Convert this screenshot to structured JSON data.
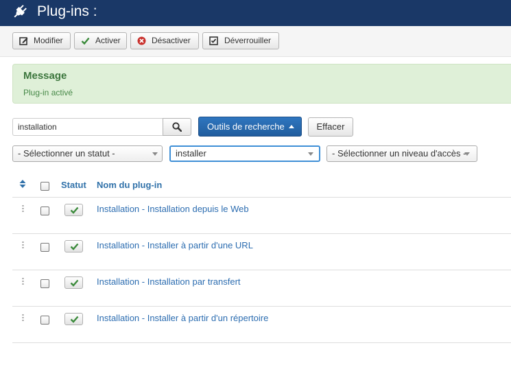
{
  "header": {
    "title": "Plug-ins :",
    "icon": "plug-icon"
  },
  "toolbar": {
    "edit_label": "Modifier",
    "enable_label": "Activer",
    "disable_label": "Désactiver",
    "unlock_label": "Déverrouiller"
  },
  "message": {
    "heading": "Message",
    "text": "Plug-in activé",
    "color": "#dff0d8"
  },
  "filters": {
    "search_value": "installation",
    "search_tools_label": "Outils de recherche",
    "clear_label": "Effacer",
    "status_select": "- Sélectionner un statut -",
    "folder_select": "installer",
    "access_select": "- Sélectionner un niveau d'accès -"
  },
  "table": {
    "col_status": "Statut",
    "col_name": "Nom du plug-in",
    "rows": [
      {
        "name": "Installation - Installation depuis le Web",
        "enabled": true
      },
      {
        "name": "Installation - Installer à partir d'une URL",
        "enabled": true
      },
      {
        "name": "Installation - Installation par transfert",
        "enabled": true
      },
      {
        "name": "Installation - Installer à partir d'un répertoire",
        "enabled": true
      }
    ]
  },
  "colors": {
    "header_bg": "#1a3867",
    "primary": "#2a69ad",
    "link": "#2b6cb0",
    "success": "#3c763d"
  }
}
